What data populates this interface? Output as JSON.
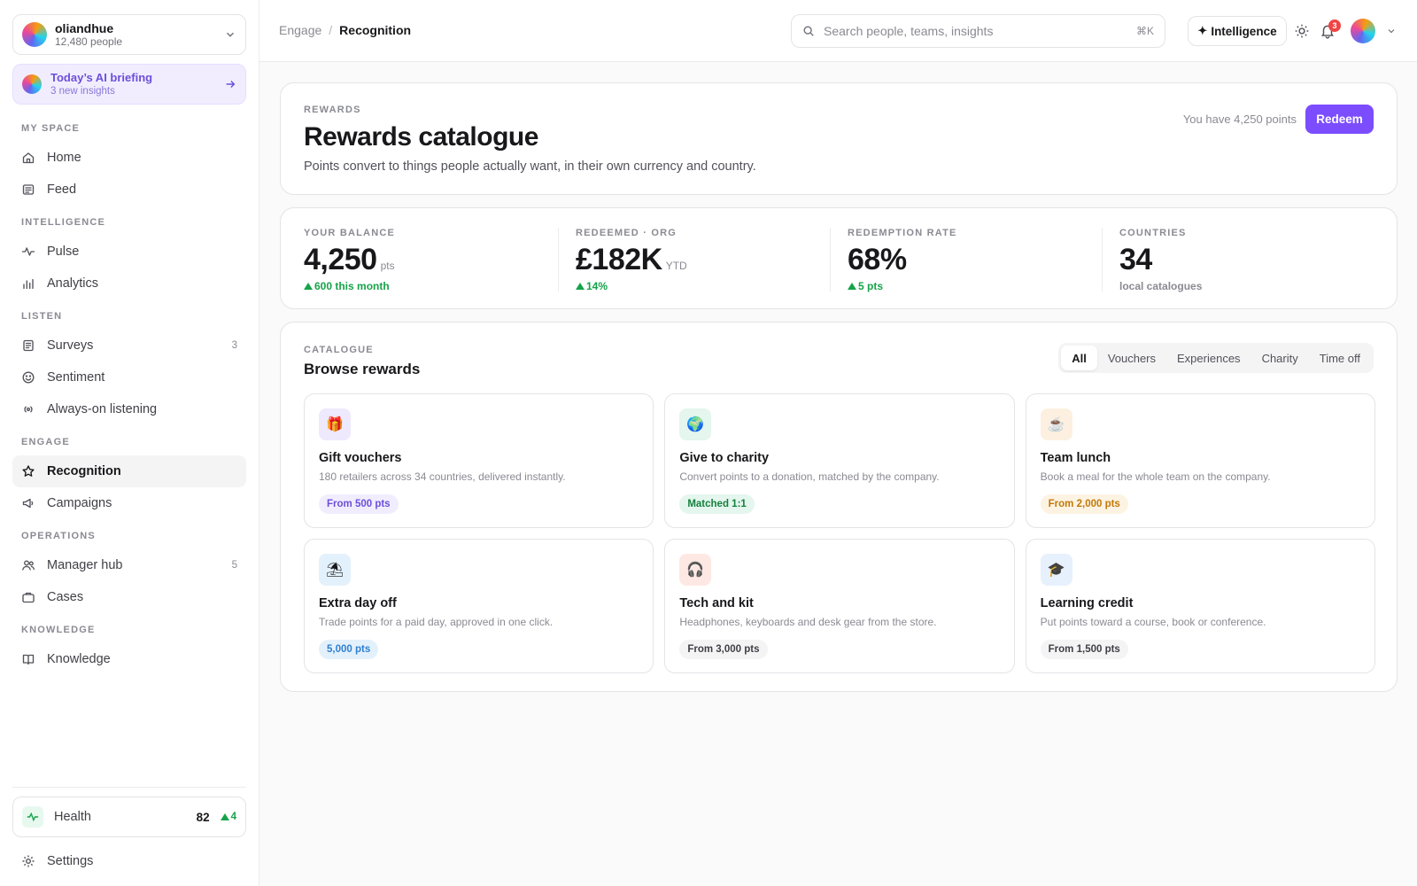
{
  "org": {
    "name": "oliandhue",
    "people": "12,480 people"
  },
  "briefing": {
    "title": "Today’s AI briefing",
    "subtitle": "3 new insights"
  },
  "nav": {
    "sections": [
      {
        "title": "MY SPACE",
        "items": [
          {
            "label": "Home",
            "icon": "home-icon"
          },
          {
            "label": "Feed",
            "icon": "feed-icon"
          }
        ]
      },
      {
        "title": "INTELLIGENCE",
        "items": [
          {
            "label": "Pulse",
            "icon": "pulse-icon"
          },
          {
            "label": "Analytics",
            "icon": "bar-chart-icon"
          }
        ]
      },
      {
        "title": "LISTEN",
        "items": [
          {
            "label": "Surveys",
            "icon": "survey-icon",
            "count": "3"
          },
          {
            "label": "Sentiment",
            "icon": "smile-icon"
          },
          {
            "label": "Always-on listening",
            "icon": "broadcast-icon"
          }
        ]
      },
      {
        "title": "ENGAGE",
        "items": [
          {
            "label": "Recognition",
            "icon": "star-icon",
            "active": true
          },
          {
            "label": "Campaigns",
            "icon": "megaphone-icon"
          }
        ]
      },
      {
        "title": "OPERATIONS",
        "items": [
          {
            "label": "Manager hub",
            "icon": "users-icon",
            "count": "5"
          },
          {
            "label": "Cases",
            "icon": "briefcase-icon"
          }
        ]
      },
      {
        "title": "KNOWLEDGE",
        "items": [
          {
            "label": "Knowledge",
            "icon": "book-icon"
          }
        ]
      }
    ]
  },
  "health": {
    "label": "Health",
    "value": "82",
    "delta": "4"
  },
  "settings": {
    "label": "Settings"
  },
  "topbar": {
    "breadcrumb": {
      "parent": "Engage",
      "separator": "/",
      "current": "Recognition"
    },
    "search": {
      "placeholder": "Search people, teams, insights",
      "value": "",
      "shortcut": "⌘K"
    },
    "intelligence_label": "Intelligence",
    "notification_count": "3"
  },
  "hero": {
    "eyebrow": "REWARDS",
    "title": "Rewards catalogue",
    "subtitle": "Points convert to things people actually want, in their own currency and country.",
    "points_text": "You have 4,250 points",
    "redeem_label": "Redeem"
  },
  "stats": [
    {
      "label": "YOUR BALANCE",
      "value": "4,250",
      "unit": "pts",
      "delta": "600 this month"
    },
    {
      "label": "REDEEMED · ORG",
      "value": "£182K",
      "unit": "YTD",
      "delta": "14%"
    },
    {
      "label": "REDEMPTION RATE",
      "value": "68%",
      "unit": "",
      "delta": "5 pts"
    },
    {
      "label": "COUNTRIES",
      "value": "34",
      "unit": "",
      "note": "local catalogues"
    }
  ],
  "catalogue": {
    "eyebrow": "CATALOGUE",
    "title": "Browse rewards",
    "filters": [
      {
        "label": "All",
        "active": true
      },
      {
        "label": "Vouchers"
      },
      {
        "label": "Experiences"
      },
      {
        "label": "Charity"
      },
      {
        "label": "Time off"
      }
    ],
    "items": [
      {
        "title": "Gift vouchers",
        "desc": "180 retailers across 34 countries, delivered instantly.",
        "tag": "From 500 pts",
        "icon": "gift-icon",
        "glyph": "🎁",
        "icon_bg": "#efe9fe",
        "tag_bg": "#f1edff",
        "tag_color": "#6d4fd8"
      },
      {
        "title": "Give to charity",
        "desc": "Convert points to a donation, matched by the company.",
        "tag": "Matched 1:1",
        "icon": "globe-icon",
        "glyph": "🌍",
        "icon_bg": "#e4f6ee",
        "tag_bg": "#e4f6ee",
        "tag_color": "#15803d"
      },
      {
        "title": "Team lunch",
        "desc": "Book a meal for the whole team on the company.",
        "tag": "From 2,000 pts",
        "icon": "coffee-icon",
        "glyph": "☕",
        "icon_bg": "#fdf0e0",
        "tag_bg": "#fdf3e2",
        "tag_color": "#c2790a"
      },
      {
        "title": "Extra day off",
        "desc": "Trade points for a paid day, approved in one click.",
        "tag": "5,000 pts",
        "icon": "beach-icon",
        "glyph": "⛱",
        "icon_bg": "#e3f1fc",
        "tag_bg": "#e3f1fc",
        "tag_color": "#2f7fd0"
      },
      {
        "title": "Tech and kit",
        "desc": "Headphones, keyboards and desk gear from the store.",
        "tag": "From 3,000 pts",
        "icon": "headphones-icon",
        "glyph": "🎧",
        "icon_bg": "#fde8e3",
        "tag_bg": "#f4f4f5",
        "tag_color": "#3f3f46"
      },
      {
        "title": "Learning credit",
        "desc": "Put points toward a course, book or conference.",
        "tag": "From 1,500 pts",
        "icon": "graduation-cap-icon",
        "glyph": "🎓",
        "icon_bg": "#e7f0fd",
        "tag_bg": "#f4f4f5",
        "tag_color": "#3f3f46"
      }
    ]
  },
  "colors": {
    "accent": "#7c4dff",
    "positive": "#16a34a",
    "badge": "#ef4444"
  }
}
